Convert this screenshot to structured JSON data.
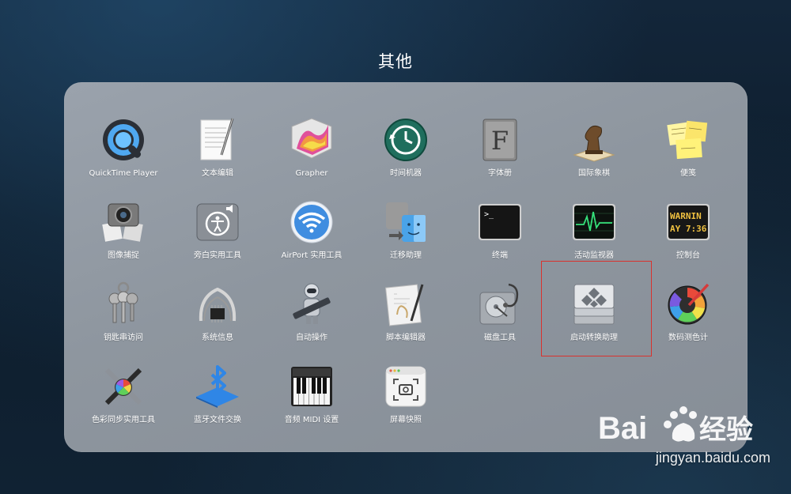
{
  "folder": {
    "title": "其他"
  },
  "apps": [
    {
      "label": "QuickTime Player",
      "icon": "quicktime-icon"
    },
    {
      "label": "文本编辑",
      "icon": "textedit-icon"
    },
    {
      "label": "Grapher",
      "icon": "grapher-icon"
    },
    {
      "label": "时间机器",
      "icon": "time-machine-icon"
    },
    {
      "label": "字体册",
      "icon": "font-book-icon"
    },
    {
      "label": "国际象棋",
      "icon": "chess-icon"
    },
    {
      "label": "便笺",
      "icon": "stickies-icon"
    },
    {
      "label": "图像捕捉",
      "icon": "image-capture-icon"
    },
    {
      "label": "旁白实用工具",
      "icon": "voiceover-utility-icon"
    },
    {
      "label": "AirPort 实用工具",
      "icon": "airport-utility-icon"
    },
    {
      "label": "迁移助理",
      "icon": "migration-assistant-icon"
    },
    {
      "label": "终端",
      "icon": "terminal-icon"
    },
    {
      "label": "活动监视器",
      "icon": "activity-monitor-icon"
    },
    {
      "label": "控制台",
      "icon": "console-icon"
    },
    {
      "label": "钥匙串访问",
      "icon": "keychain-access-icon"
    },
    {
      "label": "系统信息",
      "icon": "system-information-icon"
    },
    {
      "label": "自动操作",
      "icon": "automator-icon"
    },
    {
      "label": "脚本编辑器",
      "icon": "script-editor-icon"
    },
    {
      "label": "磁盘工具",
      "icon": "disk-utility-icon"
    },
    {
      "label": "启动转换助理",
      "icon": "boot-camp-assistant-icon"
    },
    {
      "label": "数码测色计",
      "icon": "digital-color-meter-icon"
    },
    {
      "label": "色彩同步实用工具",
      "icon": "colorsync-utility-icon"
    },
    {
      "label": "蓝牙文件交换",
      "icon": "bluetooth-file-exchange-icon"
    },
    {
      "label": "音频 MIDI 设置",
      "icon": "audio-midi-setup-icon"
    },
    {
      "label": "屏幕快照",
      "icon": "screenshot-icon"
    }
  ],
  "icon_text": {
    "font_book": "F",
    "terminal": ">_",
    "console_line1": "WARNIN",
    "console_line2": "AY 7:36"
  },
  "highlighted_app": "启动转换助理",
  "colors": {
    "highlight": "#d9322e",
    "panel": "#8e969f",
    "label": "#ffffff"
  },
  "watermark": {
    "logo_text": "Bai",
    "logo_text2": "经验",
    "url": "jingyan.baidu.com"
  }
}
